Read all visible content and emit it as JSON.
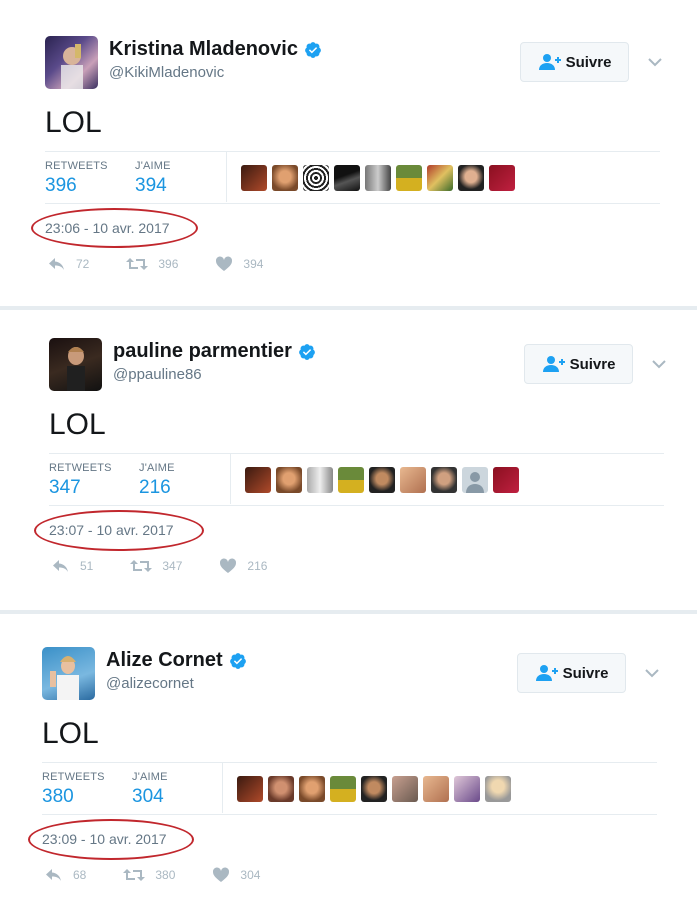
{
  "tweets": [
    {
      "name": "Kristina Mladenovic",
      "handle": "@KikiMladenovic",
      "follow_label": "Suivre",
      "text": "LOL",
      "retweets_label": "RETWEETS",
      "retweets": "396",
      "likes_label": "J'AIME",
      "likes": "394",
      "timestamp": "23:06 - 10 avr. 2017",
      "replies_count": "72",
      "retweet_count": "396",
      "like_count": "394"
    },
    {
      "name": "pauline parmentier",
      "handle": "@ppauline86",
      "follow_label": "Suivre",
      "text": "LOL",
      "retweets_label": "RETWEETS",
      "retweets": "347",
      "likes_label": "J'AIME",
      "likes": "216",
      "timestamp": "23:07 - 10 avr. 2017",
      "replies_count": "51",
      "retweet_count": "347",
      "like_count": "216"
    },
    {
      "name": "Alize Cornet",
      "handle": "@alizecornet",
      "follow_label": "Suivre",
      "text": "LOL",
      "retweets_label": "RETWEETS",
      "retweets": "380",
      "likes_label": "J'AIME",
      "likes": "304",
      "timestamp": "23:09 - 10 avr. 2017",
      "replies_count": "68",
      "retweet_count": "380",
      "like_count": "304"
    }
  ],
  "colors": {
    "accent": "#1b95e0",
    "verified": "#1da1f2",
    "muted": "#657786",
    "action_icon": "#aab8c2",
    "annotation_circle": "#c1272d"
  },
  "icons": {
    "verified": "verified-badge-icon",
    "follow": "add-user-icon",
    "caret": "chevron-down-icon",
    "reply": "reply-icon",
    "retweet": "retweet-icon",
    "like": "heart-icon"
  }
}
